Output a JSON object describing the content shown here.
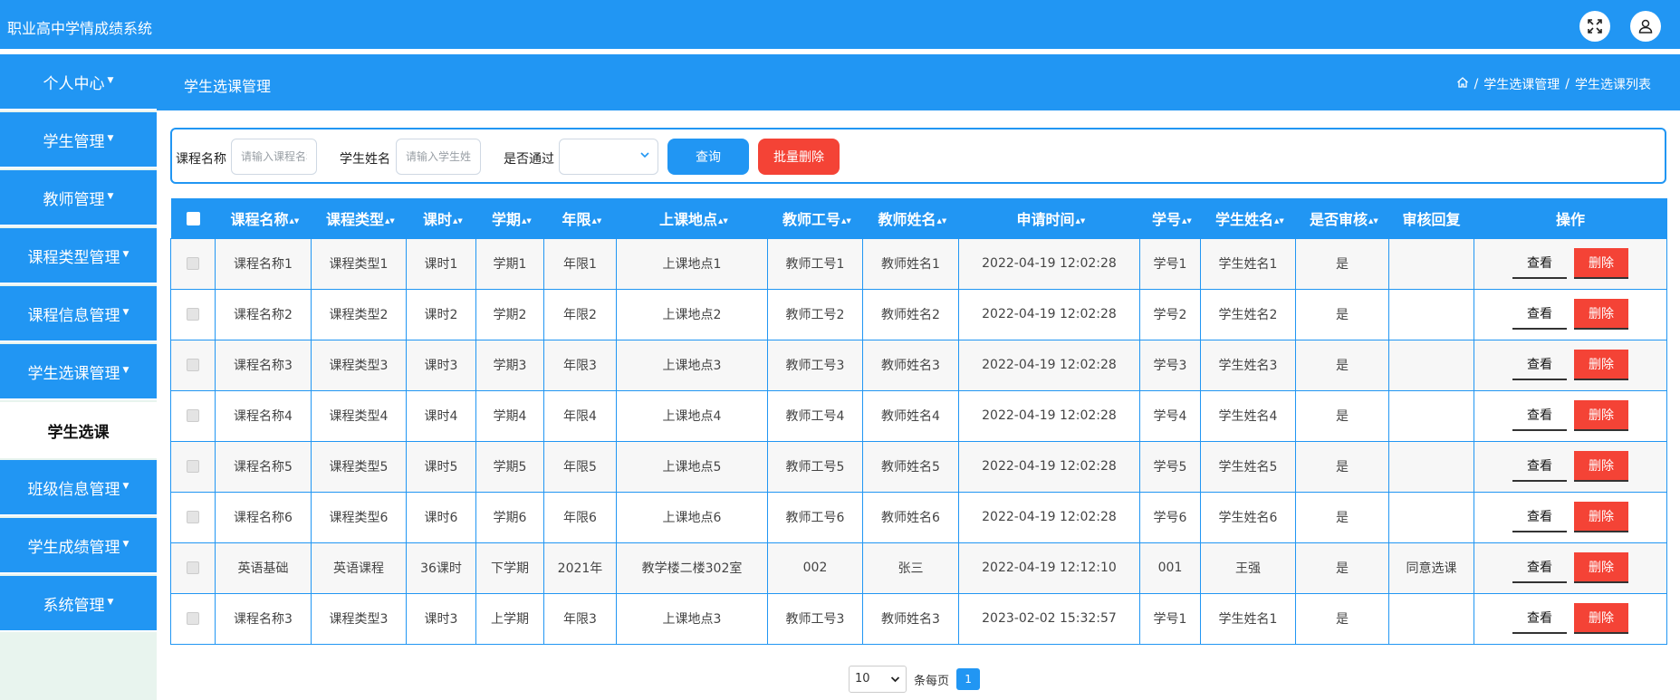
{
  "app": {
    "title": "职业高中学情成绩系统"
  },
  "header": {
    "expand_icon": "expand-icon",
    "user_icon": "user-icon"
  },
  "sidebar": {
    "items": [
      {
        "label": "个人中心",
        "top": 0
      },
      {
        "label": "学生管理"
      },
      {
        "label": "教师管理"
      },
      {
        "label": "课程类型管理"
      },
      {
        "label": "课程信息管理"
      },
      {
        "label": "学生选课管理"
      },
      {
        "label": "班级信息管理"
      },
      {
        "label": "学生成绩管理"
      },
      {
        "label": "系统管理"
      }
    ],
    "active_sub": "学生选课"
  },
  "crumbbar": {
    "title": "学生选课管理",
    "breadcrumb": [
      "学生选课管理",
      "学生选课列表"
    ],
    "separator": "/"
  },
  "search": {
    "course_label": "课程名称",
    "course_placeholder": "请输入课程名称",
    "student_label": "学生姓名",
    "student_placeholder": "请输入学生姓名",
    "passed_label": "是否通过",
    "passed_value": "",
    "query_label": "查询",
    "batch_delete_label": "批量删除"
  },
  "table": {
    "columns": [
      "课程名称",
      "课程类型",
      "课时",
      "学期",
      "年限",
      "上课地点",
      "教师工号",
      "教师姓名",
      "申请时间",
      "学号",
      "学生姓名",
      "是否审核",
      "审核回复",
      "操作"
    ],
    "view_label": "查看",
    "delete_label": "删除",
    "rows": [
      [
        "课程名称1",
        "课程类型1",
        "课时1",
        "学期1",
        "年限1",
        "上课地点1",
        "教师工号1",
        "教师姓名1",
        "2022-04-19 12:02:28",
        "学号1",
        "学生姓名1",
        "是",
        ""
      ],
      [
        "课程名称2",
        "课程类型2",
        "课时2",
        "学期2",
        "年限2",
        "上课地点2",
        "教师工号2",
        "教师姓名2",
        "2022-04-19 12:02:28",
        "学号2",
        "学生姓名2",
        "是",
        ""
      ],
      [
        "课程名称3",
        "课程类型3",
        "课时3",
        "学期3",
        "年限3",
        "上课地点3",
        "教师工号3",
        "教师姓名3",
        "2022-04-19 12:02:28",
        "学号3",
        "学生姓名3",
        "是",
        ""
      ],
      [
        "课程名称4",
        "课程类型4",
        "课时4",
        "学期4",
        "年限4",
        "上课地点4",
        "教师工号4",
        "教师姓名4",
        "2022-04-19 12:02:28",
        "学号4",
        "学生姓名4",
        "是",
        ""
      ],
      [
        "课程名称5",
        "课程类型5",
        "课时5",
        "学期5",
        "年限5",
        "上课地点5",
        "教师工号5",
        "教师姓名5",
        "2022-04-19 12:02:28",
        "学号5",
        "学生姓名5",
        "是",
        ""
      ],
      [
        "课程名称6",
        "课程类型6",
        "课时6",
        "学期6",
        "年限6",
        "上课地点6",
        "教师工号6",
        "教师姓名6",
        "2022-04-19 12:02:28",
        "学号6",
        "学生姓名6",
        "是",
        ""
      ],
      [
        "英语基础",
        "英语课程",
        "36课时",
        "下学期",
        "2021年",
        "教学楼二楼302室",
        "002",
        "张三",
        "2022-04-19 12:12:10",
        "001",
        "王强",
        "是",
        "同意选课"
      ],
      [
        "课程名称3",
        "课程类型3",
        "课时3",
        "上学期",
        "年限3",
        "上课地点3",
        "教师工号3",
        "教师姓名3",
        "2023-02-02 15:32:57",
        "学号1",
        "学生姓名1",
        "是",
        ""
      ]
    ]
  },
  "pager": {
    "page_size": "10",
    "per_page_label": "条每页",
    "current_page": "1"
  },
  "colors": {
    "primary": "#2196f3",
    "danger": "#f44336",
    "sidebar_bg": "#e8f4ee"
  }
}
